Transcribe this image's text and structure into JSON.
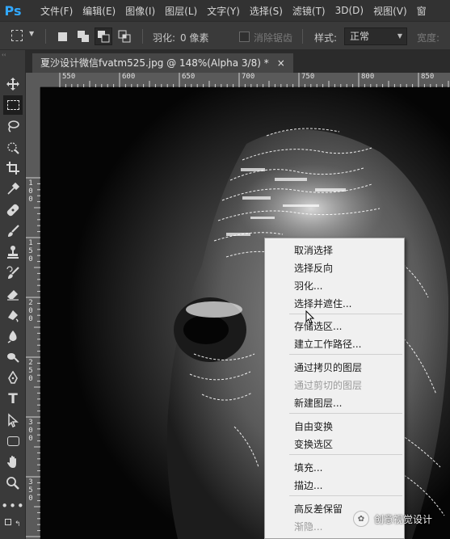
{
  "app": {
    "logo": "Ps"
  },
  "menubar": {
    "items": [
      "文件(F)",
      "编辑(E)",
      "图像(I)",
      "图层(L)",
      "文字(Y)",
      "选择(S)",
      "滤镜(T)",
      "3D(D)",
      "视图(V)",
      "窗"
    ]
  },
  "options": {
    "feather_label": "羽化:",
    "feather_value": "0 像素",
    "antialias_label": "消除锯齿",
    "style_label": "样式:",
    "style_value": "正常",
    "width_label": "宽度:"
  },
  "document": {
    "tab_title": "夏沙设计微信fvatm525.jpg @ 148%(Alpha 3/8) *",
    "close_glyph": "×"
  },
  "ruler": {
    "top_labels": [
      "550",
      "600",
      "650",
      "700",
      "750",
      "800",
      "850"
    ],
    "left_labels": [
      "1 0 0",
      "1 5 0",
      "2 0 0",
      "2 5 0",
      "3 0 0",
      "3 5 0"
    ]
  },
  "context_menu": {
    "items": [
      {
        "label": "取消选择",
        "enabled": true
      },
      {
        "label": "选择反向",
        "enabled": true
      },
      {
        "label": "羽化...",
        "enabled": true
      },
      {
        "label": "选择并遮住...",
        "enabled": true
      },
      {
        "label": "存储选区...",
        "enabled": true
      },
      {
        "label": "建立工作路径...",
        "enabled": true
      },
      {
        "label": "通过拷贝的图层",
        "enabled": true
      },
      {
        "label": "通过剪切的图层",
        "enabled": false
      },
      {
        "label": "新建图层...",
        "enabled": true
      },
      {
        "label": "自由变换",
        "enabled": true
      },
      {
        "label": "变换选区",
        "enabled": true
      },
      {
        "label": "填充...",
        "enabled": true
      },
      {
        "label": "描边...",
        "enabled": true
      },
      {
        "label": "高反差保留",
        "enabled": true
      },
      {
        "label": "渐隐...",
        "enabled": false
      }
    ]
  },
  "watermark": {
    "text": "创意视觉设计"
  },
  "toolbar": {
    "tools": [
      "move-icon",
      "marquee-icon",
      "lasso-icon",
      "quick-select-icon",
      "crop-icon",
      "eyedropper-icon",
      "healing-icon",
      "brush-icon",
      "stamp-icon",
      "history-brush-icon",
      "eraser-icon",
      "gradient-icon",
      "blur-icon",
      "dodge-icon",
      "pen-icon",
      "type-icon",
      "path-select-icon",
      "shape-icon",
      "hand-icon",
      "zoom-icon",
      "more-icon"
    ],
    "type_tool_glyph": "T"
  },
  "colors": {
    "ps_blue": "#31a8ff",
    "menubar_bg": "#323232",
    "panel_bg": "#3a3a3a",
    "menu_bg": "#f0f0f0"
  }
}
